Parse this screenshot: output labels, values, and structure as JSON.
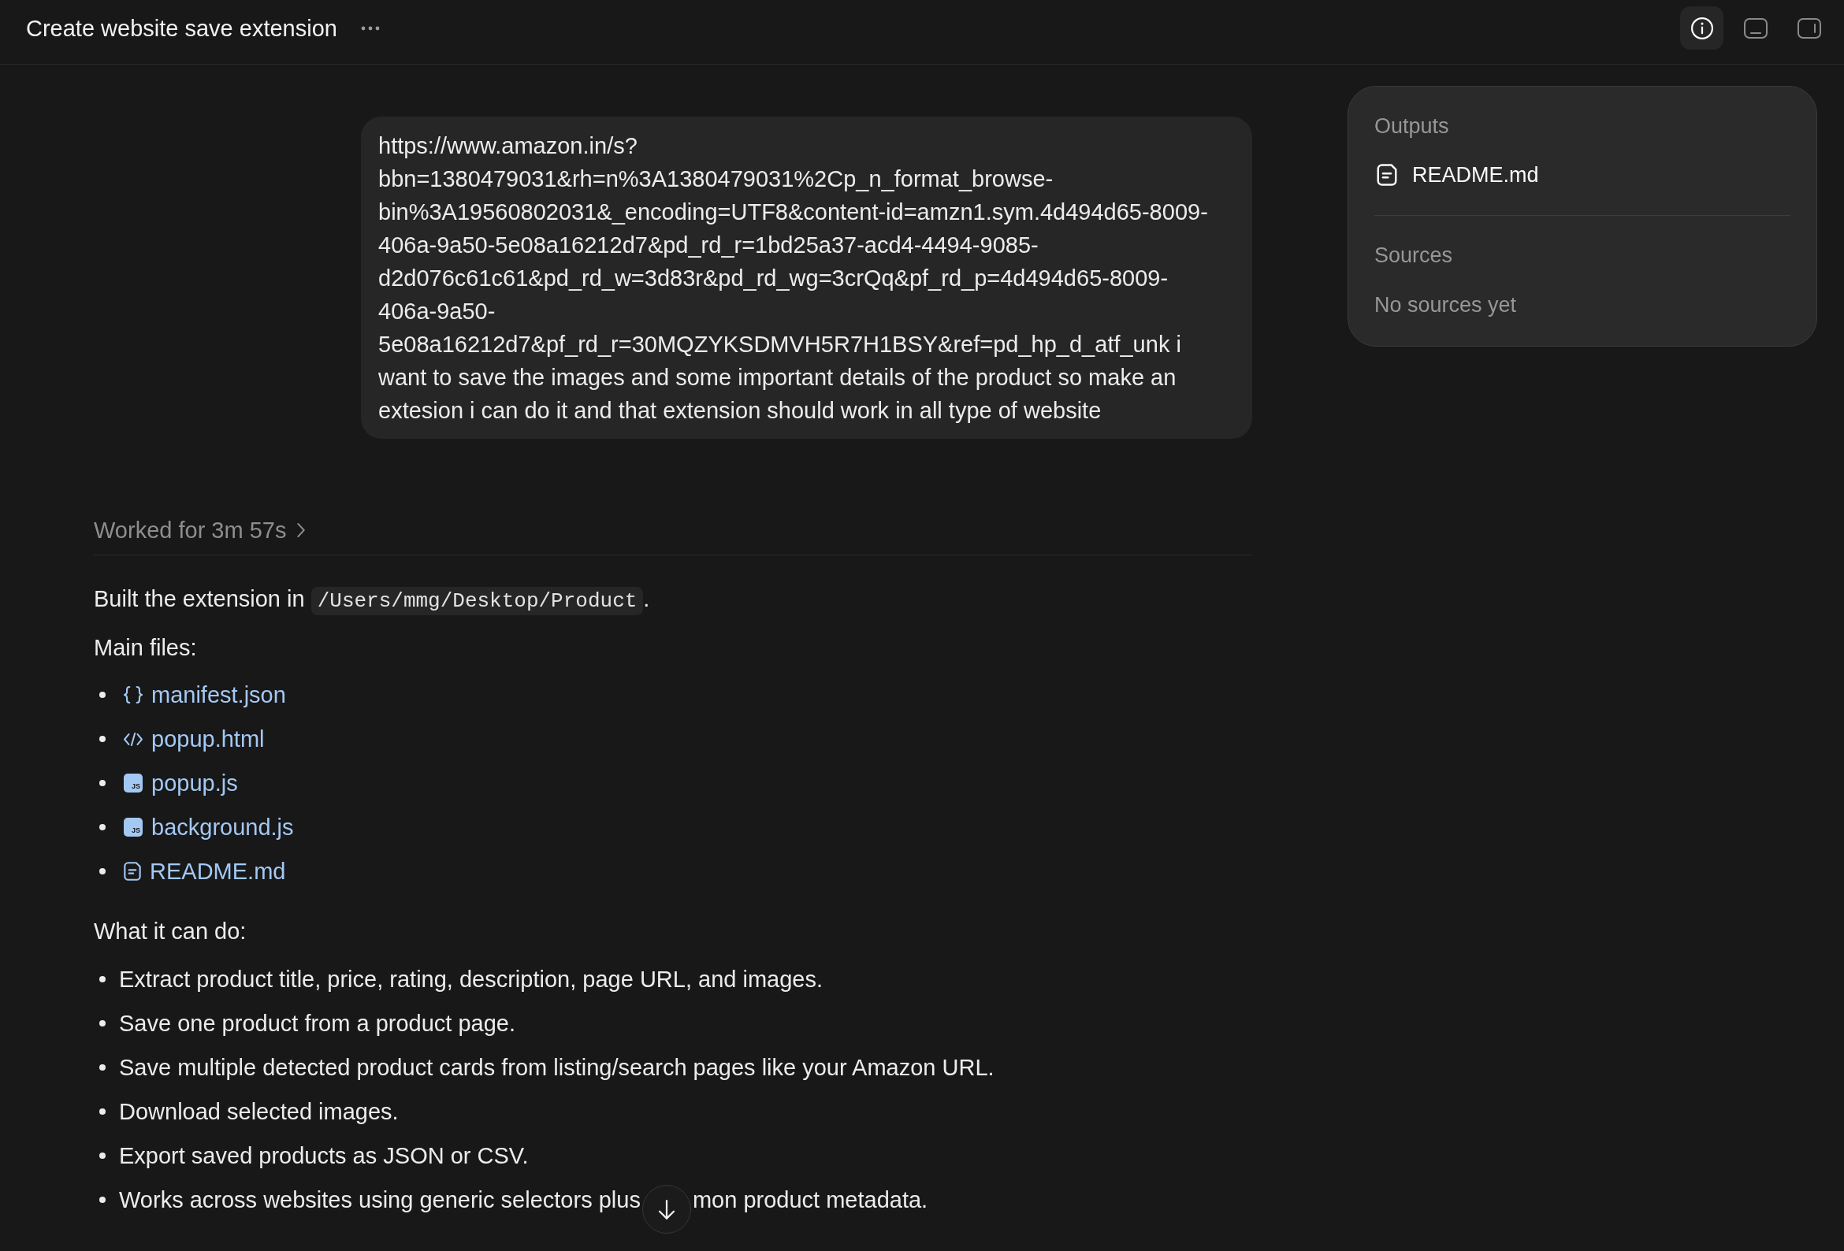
{
  "window": {
    "title": "Create website save extension"
  },
  "toolbar": {
    "buttons": [
      {
        "kind": "info",
        "on": true
      },
      {
        "kind": "bottom-panel",
        "on": false
      },
      {
        "kind": "side-panel",
        "on": false
      }
    ]
  },
  "conversation": {
    "user_message": "https://www.amazon.in/s?bbn=1380479031&rh=n%3A1380479031%2Cp_n_format_browse-bin%3A19560802031&_encoding=UTF8&content-id=amzn1.sym.4d494d65-8009-406a-9a50-5e08a16212d7&pd_rd_r=1bd25a37-acd4-4494-9085-d2d076c61c61&pd_rd_w=3d83r&pd_rd_wg=3crQq&pf_rd_p=4d494d65-8009-406a-9a50-5e08a16212d7&pf_rd_r=30MQZYKSDMVH5R7H1BSY&ref=pd_hp_d_atf_unk i want to save the images and some important details of the product so make an extesion i can do it and that extension should work in all type of website",
    "work_summary": {
      "label": "Worked for 3m 57s",
      "expanded": false
    },
    "response": {
      "intro": {
        "text": "Built the extension in",
        "code": "/Users/mmg/Desktop/Product",
        "end": "."
      },
      "files_heading": "Main files:",
      "files": [
        {
          "name": "manifest.json",
          "kind": "json"
        },
        {
          "name": "popup.html",
          "kind": "html"
        },
        {
          "name": "popup.js",
          "kind": "js",
          "icon_label": "JS"
        },
        {
          "name": "background.js",
          "kind": "js",
          "icon_label": "JS"
        },
        {
          "name": "README.md",
          "kind": "doc"
        }
      ],
      "features_heading": "What it can do:",
      "features": [
        {
          "text": "Extract product title, price, rating, description, page URL, and images."
        },
        {
          "text": "Save one product from a product page."
        },
        {
          "text": "Save multiple detected product cards from listing/search pages like your Amazon URL."
        },
        {
          "text": "Download selected images."
        },
        {
          "text": "Export saved products as JSON or CSV."
        },
        {
          "text": "Works across websites using generic selectors plus",
          "text_after_button": "mon product metadata."
        }
      ]
    }
  },
  "side_panel": {
    "outputs_heading": "Outputs",
    "outputs": [
      {
        "name": "README.md",
        "kind": "doc"
      }
    ],
    "sources_heading": "Sources",
    "sources_empty": "No sources yet"
  }
}
